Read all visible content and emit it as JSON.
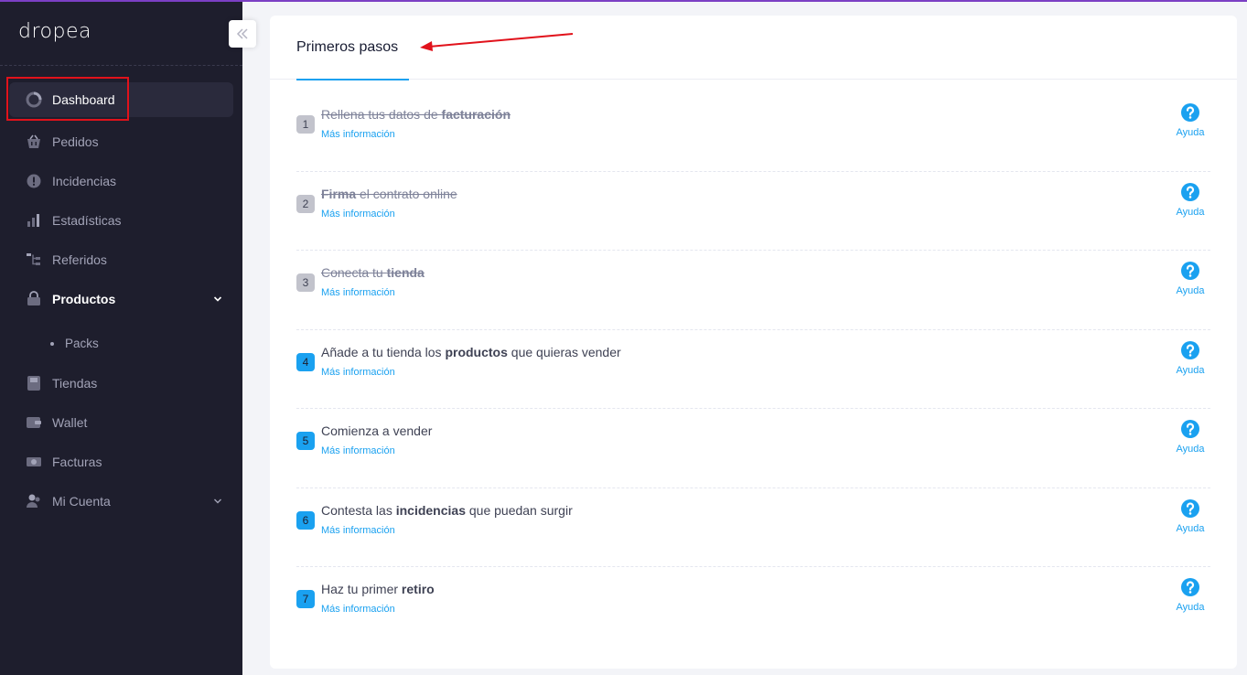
{
  "app": {
    "logo": "dropea"
  },
  "sidebar": {
    "items": [
      {
        "label": "Dashboard",
        "icon": "dashboard-icon"
      },
      {
        "label": "Pedidos",
        "icon": "basket-icon"
      },
      {
        "label": "Incidencias",
        "icon": "alert-icon"
      },
      {
        "label": "Estadísticas",
        "icon": "chart-icon"
      },
      {
        "label": "Referidos",
        "icon": "tree-icon"
      },
      {
        "label": "Productos",
        "icon": "bag-icon"
      },
      {
        "label": "Packs",
        "icon": "dot"
      },
      {
        "label": "Tiendas",
        "icon": "store-icon"
      },
      {
        "label": "Wallet",
        "icon": "wallet-icon"
      },
      {
        "label": "Facturas",
        "icon": "invoice-icon"
      },
      {
        "label": "Mi Cuenta",
        "icon": "users-icon"
      }
    ]
  },
  "main": {
    "title": "Primeros pasos",
    "more_label": "Más información",
    "help_label": "Ayuda",
    "steps": [
      {
        "num": "1",
        "done": true,
        "pre": "Rellena tus datos de ",
        "bold": "facturación",
        "post": ""
      },
      {
        "num": "2",
        "done": true,
        "pre": "",
        "bold": "Firma",
        "post": " el contrato online"
      },
      {
        "num": "3",
        "done": true,
        "pre": "Conecta tu ",
        "bold": "tienda",
        "post": ""
      },
      {
        "num": "4",
        "done": false,
        "pre": "Añade a tu tienda los ",
        "bold": "productos",
        "post": " que quieras vender"
      },
      {
        "num": "5",
        "done": false,
        "pre": "Comienza a vender",
        "bold": "",
        "post": ""
      },
      {
        "num": "6",
        "done": false,
        "pre": "Contesta las ",
        "bold": "incidencias",
        "post": " que puedan surgir"
      },
      {
        "num": "7",
        "done": false,
        "pre": "Haz tu primer ",
        "bold": "retiro",
        "post": ""
      }
    ]
  },
  "colors": {
    "sidebar_bg": "#1e1e2d",
    "accent": "#1aa1f0",
    "annotation": "#e1121b",
    "top_line": "#7b3fc4"
  }
}
